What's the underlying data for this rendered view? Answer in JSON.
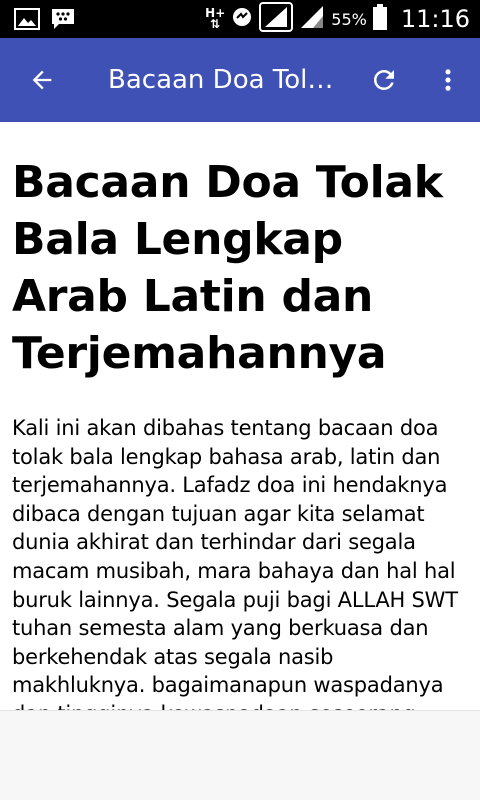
{
  "status_bar": {
    "network_type": "H+",
    "battery": "55%",
    "time": "11:16"
  },
  "app_bar": {
    "title": "Bacaan Doa Tolak Bala Lengkap Arab Latin dan Terjemahannya",
    "color": "#3f51b5",
    "icons": {
      "back": "arrow-left-icon",
      "refresh": "refresh-icon",
      "overflow": "more-vert-icon"
    }
  },
  "article": {
    "title": "Bacaan Doa Tolak Bala Lengkap Arab Latin dan Terjemahannya",
    "body": "Kali ini akan dibahas tentang bacaan doa tolak bala lengkap bahasa arab, latin dan terjemahannya. Lafadz doa ini hendaknya dibaca dengan tujuan agar kita selamat dunia akhirat dan terhindar dari segala macam musibah, mara bahaya dan hal hal buruk lainnya. Segala puji bagi ALLAH SWT tuhan semesta alam yang berkuasa dan berkehendak atas segala nasib makhluknya. bagaimanapun waspadanya dan tingginya kewaspadaan seseorang"
  }
}
